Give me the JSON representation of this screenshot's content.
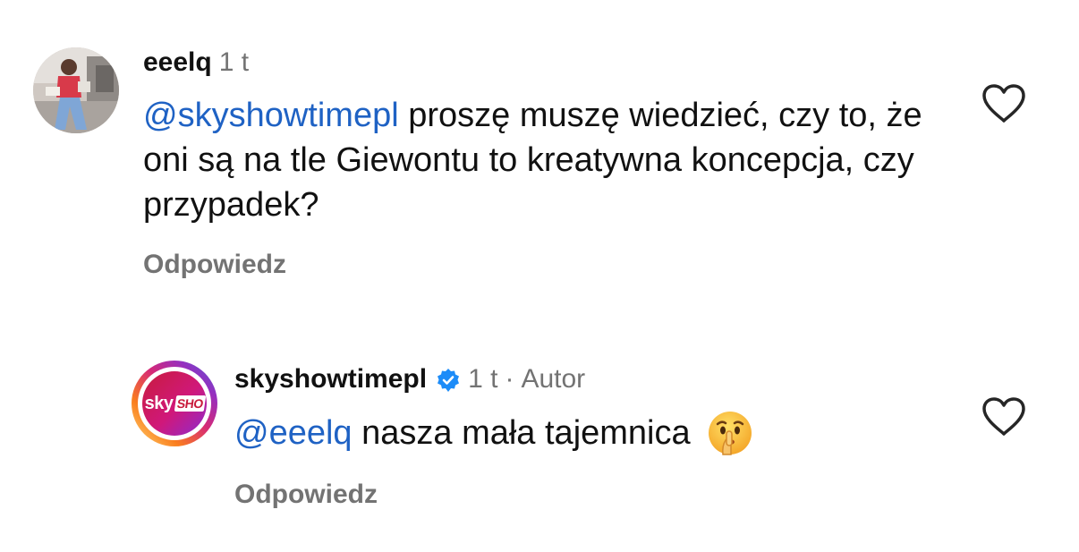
{
  "comments": [
    {
      "username": "eeelq",
      "time": "1 t",
      "mention": "@skyshowtimepl",
      "text": " proszę muszę wiedzieć, czy to, że oni są na tle Giewontu to kreatywna koncepcja, czy przypadek?",
      "reply_label": "Odpowiedz",
      "like_icon": "heart-outline-icon",
      "avatar": "user-photo-avatar"
    },
    {
      "username": "skyshowtimepl",
      "verified": true,
      "verified_icon": "verified-badge-icon",
      "time": "1 t",
      "separator": "·",
      "author_label": "Autor",
      "mention": "@eeelq",
      "text": " nasza mała tajemnica",
      "emoji": "shushing-face-emoji",
      "reply_label": "Odpowiedz",
      "like_icon": "heart-outline-icon",
      "avatar": "skyshowtime-logo-avatar",
      "avatar_logo_text": "sky",
      "avatar_logo_badge": "SHO"
    }
  ],
  "colors": {
    "mention": "#1f62c4",
    "meta": "#737373",
    "verified": "#1d8cf8",
    "text": "#111111"
  }
}
